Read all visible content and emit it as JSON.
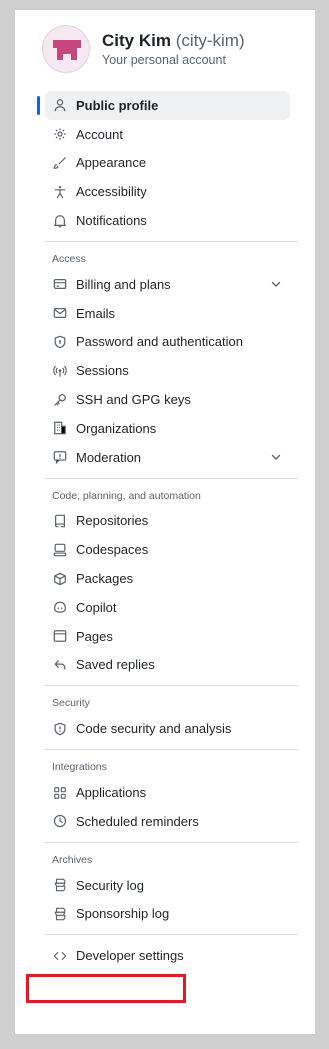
{
  "profile": {
    "name": "City Kim",
    "handle": "(city-kim)",
    "subtitle": "Your personal account"
  },
  "main_items": [
    {
      "label": "Public profile",
      "icon": "person-icon",
      "active": true
    },
    {
      "label": "Account",
      "icon": "gear-icon"
    },
    {
      "label": "Appearance",
      "icon": "paintbrush-icon"
    },
    {
      "label": "Accessibility",
      "icon": "accessibility-icon"
    },
    {
      "label": "Notifications",
      "icon": "bell-icon"
    }
  ],
  "sections": [
    {
      "title": "Access",
      "items": [
        {
          "label": "Billing and plans",
          "icon": "credit-card-icon",
          "expandable": true
        },
        {
          "label": "Emails",
          "icon": "mail-icon"
        },
        {
          "label": "Password and authentication",
          "icon": "shield-lock-icon"
        },
        {
          "label": "Sessions",
          "icon": "broadcast-icon"
        },
        {
          "label": "SSH and GPG keys",
          "icon": "key-icon"
        },
        {
          "label": "Organizations",
          "icon": "organization-icon"
        },
        {
          "label": "Moderation",
          "icon": "report-icon",
          "expandable": true
        }
      ]
    },
    {
      "title": "Code, planning, and automation",
      "items": [
        {
          "label": "Repositories",
          "icon": "repo-icon"
        },
        {
          "label": "Codespaces",
          "icon": "codespaces-icon"
        },
        {
          "label": "Packages",
          "icon": "package-icon"
        },
        {
          "label": "Copilot",
          "icon": "copilot-icon"
        },
        {
          "label": "Pages",
          "icon": "browser-icon"
        },
        {
          "label": "Saved replies",
          "icon": "reply-icon"
        }
      ]
    },
    {
      "title": "Security",
      "items": [
        {
          "label": "Code security and analysis",
          "icon": "shield-icon"
        }
      ]
    },
    {
      "title": "Integrations",
      "items": [
        {
          "label": "Applications",
          "icon": "apps-icon"
        },
        {
          "label": "Scheduled reminders",
          "icon": "clock-icon"
        }
      ]
    },
    {
      "title": "Archives",
      "items": [
        {
          "label": "Security log",
          "icon": "log-icon"
        },
        {
          "label": "Sponsorship log",
          "icon": "log-icon"
        }
      ]
    }
  ],
  "footer_items": [
    {
      "label": "Developer settings",
      "icon": "code-icon",
      "highlighted": true
    }
  ],
  "colors": {
    "accent": "#0969da",
    "highlight_border": "#e01b24",
    "avatar_pink": "#c8467f"
  }
}
